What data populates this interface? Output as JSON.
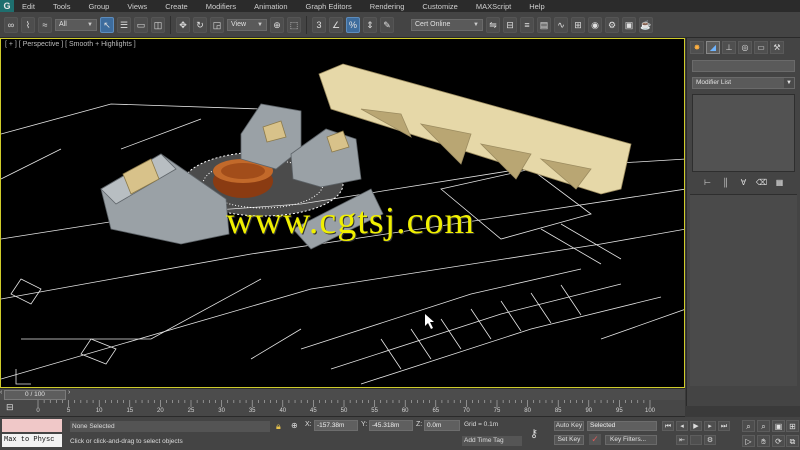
{
  "app": {
    "logo": "G"
  },
  "menu": [
    "Edit",
    "Tools",
    "Group",
    "Views",
    "Create",
    "Modifiers",
    "Animation",
    "Graph Editors",
    "Rendering",
    "Customize",
    "MAXScript",
    "Help"
  ],
  "toolbar": {
    "selection_filter": "All",
    "reference_coord": "View",
    "named_selection": "Cert Online",
    "snap_value": "3"
  },
  "viewport": {
    "label": "[ + ] [ Perspective ] [ Smooth + Highlights ]",
    "watermark": "www.cgtsj.com",
    "border_color": "#cfcc2a"
  },
  "command_panel": {
    "tabs": [
      "create-icon",
      "modify-icon",
      "hierarchy-icon",
      "motion-icon",
      "display-icon",
      "utilities-icon"
    ],
    "modifier_list": "Modifier List"
  },
  "timeline": {
    "frame_display": "0 / 100",
    "ticks": [
      0,
      5,
      10,
      15,
      20,
      25,
      30,
      35,
      40,
      45,
      50,
      55,
      60,
      65,
      70,
      75,
      80,
      85,
      90,
      95,
      100
    ]
  },
  "status": {
    "maxscript_mini": "Max to Physc",
    "selection": "None Selected",
    "prompt": "Click or click-and-drag to select objects",
    "x_label": "X:",
    "x_value": "-157.38m",
    "y_label": "Y:",
    "y_value": "-45.318m",
    "z_label": "Z:",
    "z_value": "0.0m",
    "grid": "Grid = 0.1m",
    "add_time_tag": "Add Time Tag",
    "auto_key": "Auto Key",
    "set_key": "Set Key",
    "key_mode": "Selected",
    "key_filters": "Key Filters..."
  }
}
